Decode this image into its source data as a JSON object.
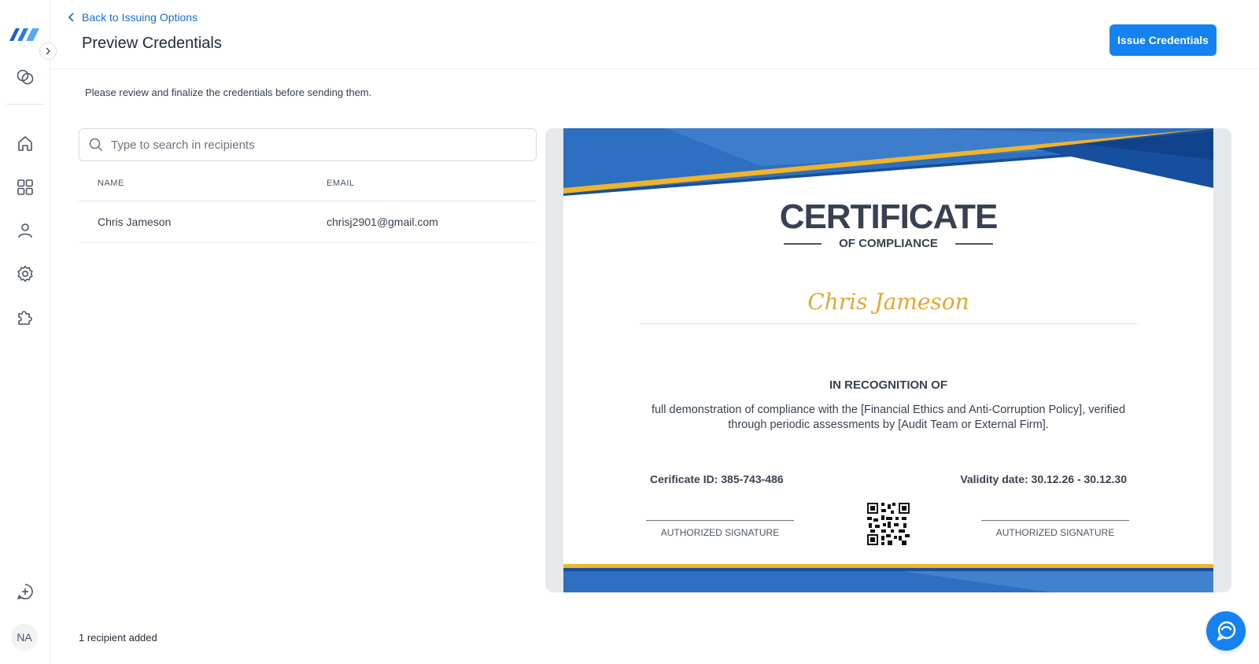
{
  "app": {
    "avatar_initials": "NA"
  },
  "header": {
    "back_label": "Back to Issuing Options",
    "title": "Preview Credentials",
    "issue_button": "Issue Credentials"
  },
  "main": {
    "description": "Please review and finalize the credentials before sending them.",
    "search_placeholder": "Type to search in recipients",
    "table": {
      "columns": [
        "NAME",
        "EMAIL"
      ],
      "rows": [
        {
          "name": "Chris Jameson",
          "email": "chrisj2901@gmail.com"
        }
      ]
    },
    "recipient_count": "1 recipient added"
  },
  "certificate": {
    "title": "CERTIFICATE",
    "subtitle": "OF COMPLIANCE",
    "recipient_name": "Chris Jameson",
    "recognition_heading": "IN RECOGNITION OF",
    "body": "full demonstration of compliance with the [Financial Ethics and Anti-Corruption Policy], verified through periodic assessments by [Audit Team or External Firm].",
    "certificate_id": "Cerificate ID: 385-743-486",
    "validity": "Validity date: 30.12.26 - 30.12.30",
    "signature_left": "AUTHORIZED SIGNATURE",
    "signature_right": "AUTHORIZED SIGNATURE",
    "colors": {
      "blue_dark": "#174f9e",
      "blue_mid": "#2d6fc0",
      "blue_light": "#4a8ad6",
      "gold": "#f0b429"
    }
  },
  "colors": {
    "primary": "#1482f0",
    "link": "#1a6fd1"
  },
  "icons": {
    "sidebar": [
      "logo-icon",
      "expand-chevron-icon",
      "overlap-circles-icon",
      "home-icon",
      "grid-icon",
      "user-icon",
      "gear-icon",
      "puzzle-icon",
      "chat-add-icon"
    ],
    "search": "search-icon",
    "back": "chevron-left-icon",
    "fab": "chat-bubble-icon"
  }
}
